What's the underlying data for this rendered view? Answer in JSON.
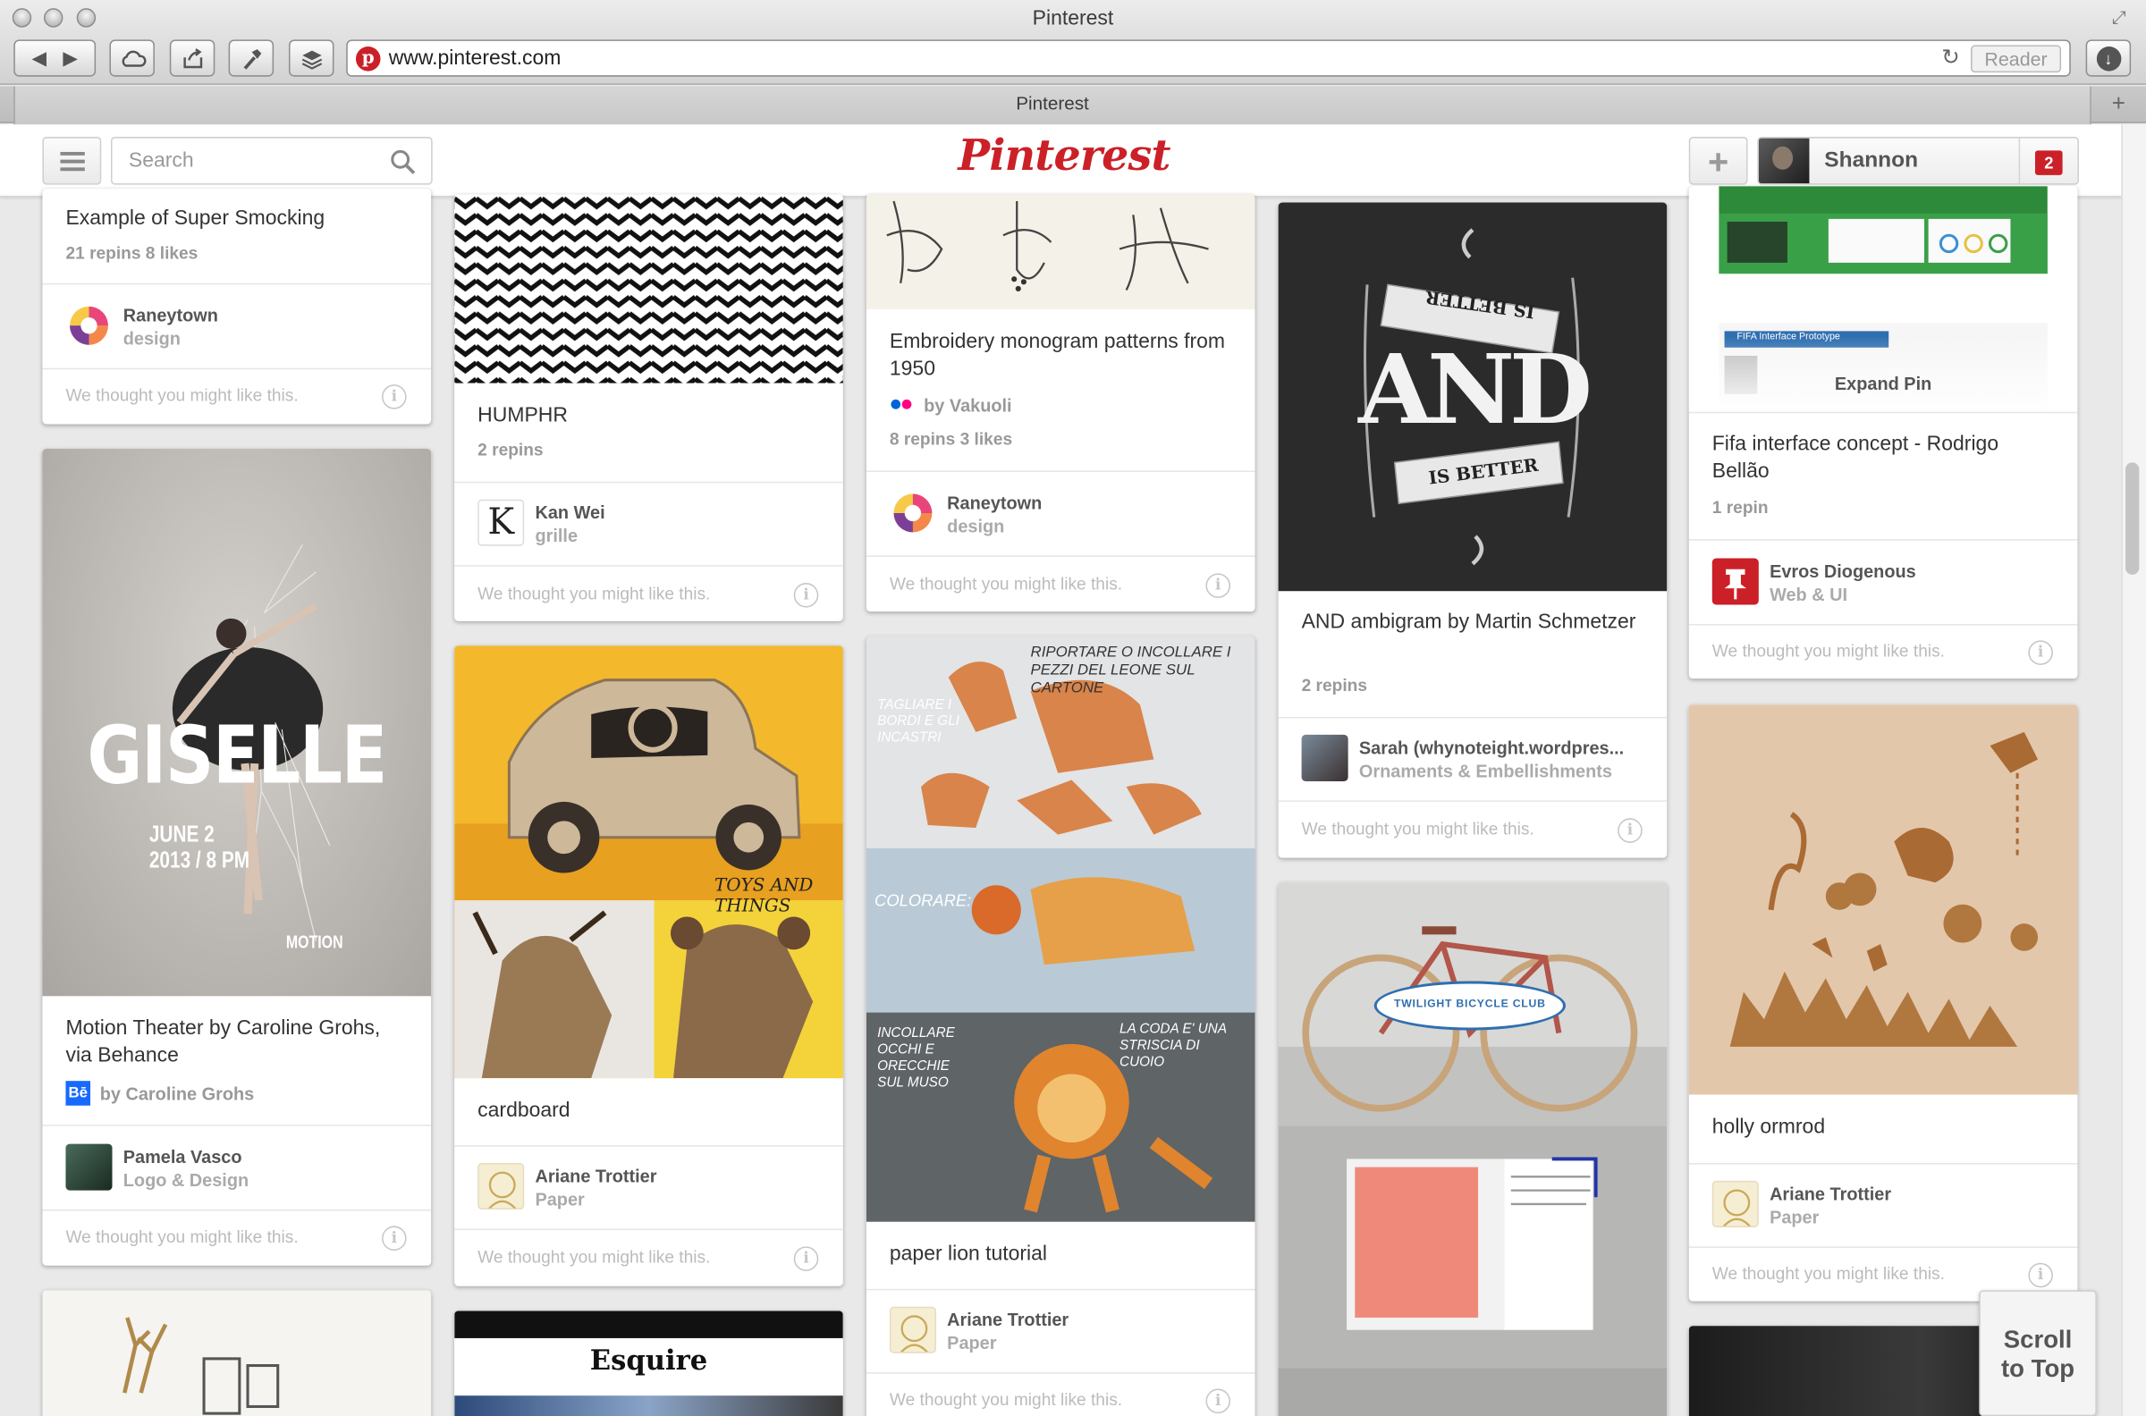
{
  "window": {
    "title": "Pinterest",
    "tab_title": "Pinterest",
    "url": "www.pinterest.com",
    "reader_label": "Reader"
  },
  "header": {
    "search_placeholder": "Search",
    "logo": "Pinterest",
    "user_name": "Shannon",
    "notification_count": "2"
  },
  "footer_text": "We thought you might like this.",
  "pins": [
    {
      "title": "Example of Super Smocking",
      "stats": "21 repins   8 likes",
      "pinner": "Raneytown",
      "board": "design"
    },
    {
      "title": "Motion Theater by Caroline Grohs, via Behance",
      "source": "by Caroline Grohs",
      "source_badge": "Bē",
      "pinner": "Pamela Vasco",
      "board": "Logo & Design",
      "poster_title": "GISELLE",
      "poster_date": "JUNE 2\n2013 / 8 PM",
      "poster_brand": "MOTION"
    },
    {
      "title": "HUMPHR",
      "stats": "2 repins",
      "pinner": "Kan Wei",
      "board": "grille",
      "avatar_letter": "K"
    },
    {
      "title": "cardboard",
      "pinner": "Ariane Trottier",
      "board": "Paper",
      "image_caption": "TOYS AND THINGS"
    },
    {
      "title": "Esquire",
      "image_masthead": "Esquire"
    },
    {
      "title": "Embroidery monogram patterns from 1950",
      "source": "by Vakuoli",
      "stats": "8 repins   3 likes",
      "pinner": "Raneytown",
      "board": "design"
    },
    {
      "title": "paper lion tutorial",
      "pinner": "Ariane Trottier",
      "board": "Paper",
      "image_texts": [
        "RIPORTARE O INCOLLARE I PEZZI DEL LEONE SUL CARTONE",
        "TAGLIARE I BORDI E GLI INCASTRI",
        "COLORARE:",
        "INCOLLARE OCCHI E ORECCHIE SUL MUSO",
        "LA CODA E' UNA STRISCIA DI CUOIO"
      ]
    },
    {
      "title": "AND ambigram by Martin Schmetzer",
      "stats": "2 repins",
      "pinner": "Sarah (whynoteight.wordpres...",
      "board": "Ornaments & Embellishments",
      "image_text": "AND",
      "image_banner": "IS BETTER"
    },
    {
      "title": "Twilight Bicycle Club",
      "image_label": "TWILIGHT BICYCLE CLUB"
    },
    {
      "title": "Fifa interface concept - Rodrigo Bellão",
      "stats": "1 repin",
      "expand_label": "Expand Pin",
      "pinner": "Evros Diogenous",
      "board": "Web & UI",
      "image_label": "FIFA Interface Prototype"
    },
    {
      "title": "holly ormrod",
      "pinner": "Ariane Trottier",
      "board": "Paper"
    }
  ],
  "scroll_to_top": "Scroll\nto Top"
}
